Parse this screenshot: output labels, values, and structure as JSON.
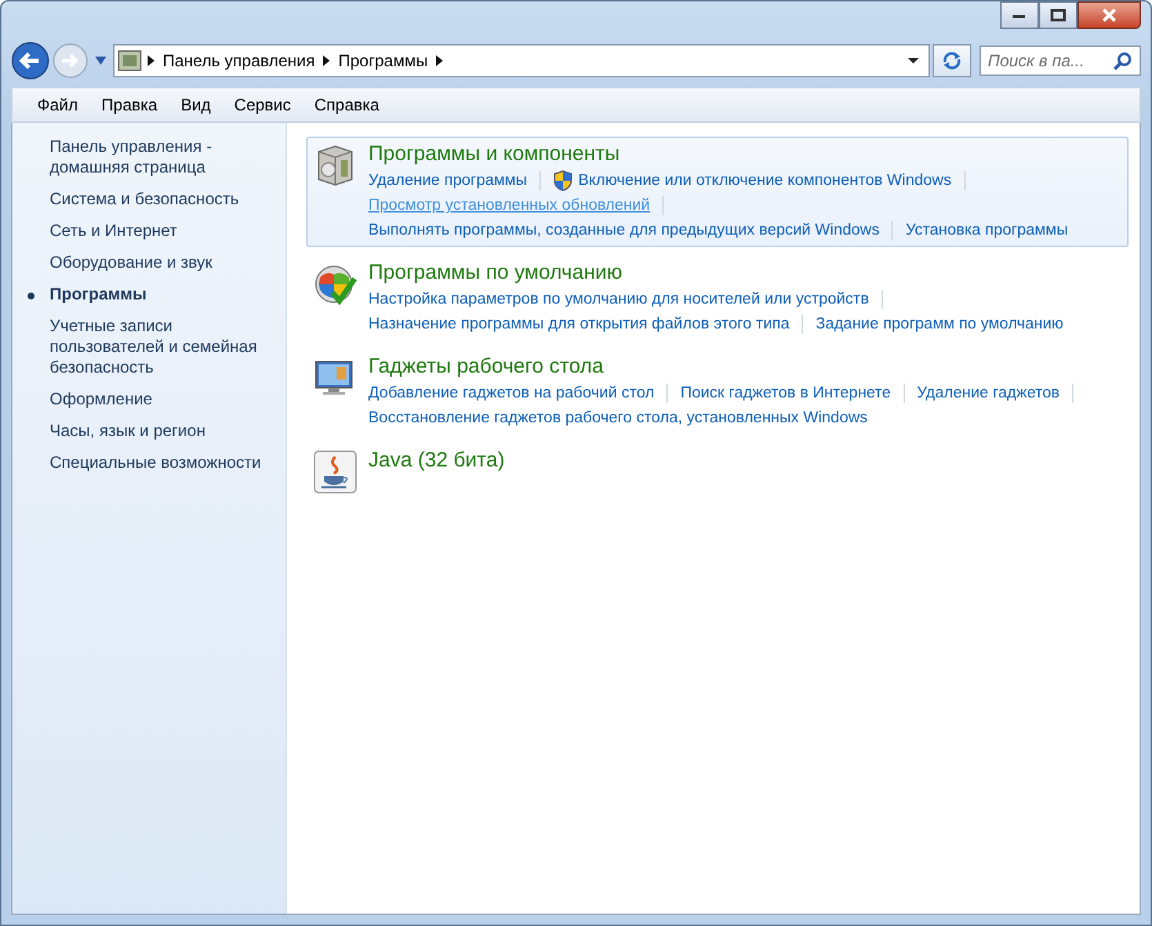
{
  "address": {
    "crumbs": [
      "Панель управления",
      "Программы"
    ]
  },
  "search": {
    "placeholder": "Поиск в па..."
  },
  "menu": [
    "Файл",
    "Правка",
    "Вид",
    "Сервис",
    "Справка"
  ],
  "sidebar": {
    "items": [
      {
        "label": "Панель управления - домашняя страница",
        "selected": false
      },
      {
        "label": "Система и безопасность",
        "selected": false
      },
      {
        "label": "Сеть и Интернет",
        "selected": false
      },
      {
        "label": "Оборудование и звук",
        "selected": false
      },
      {
        "label": "Программы",
        "selected": true
      },
      {
        "label": "Учетные записи пользователей и семейная безопасность",
        "selected": false
      },
      {
        "label": "Оформление",
        "selected": false
      },
      {
        "label": "Часы, язык и регион",
        "selected": false
      },
      {
        "label": "Специальные возможности",
        "selected": false
      }
    ]
  },
  "sections": [
    {
      "kind": "box",
      "title": "Программы и компоненты",
      "highlighted": true,
      "rows": [
        [
          {
            "label": "Удаление программы",
            "hovered": false,
            "shield": false
          },
          {
            "label": "Включение или отключение компонентов Windows",
            "hovered": false,
            "shield": true
          }
        ],
        [
          {
            "label": "Просмотр установленных обновлений",
            "hovered": true,
            "shield": false
          }
        ],
        [
          {
            "label": "Выполнять программы, созданные для предыдущих версий Windows",
            "hovered": false,
            "shield": false
          },
          {
            "label": "Установка программы",
            "hovered": false,
            "shield": false
          }
        ]
      ]
    },
    {
      "kind": "globe",
      "title": "Программы по умолчанию",
      "highlighted": false,
      "rows": [
        [
          {
            "label": "Настройка параметров по умолчанию для носителей или устройств",
            "hovered": false,
            "shield": false
          }
        ],
        [
          {
            "label": "Назначение программы для открытия файлов этого типа",
            "hovered": false,
            "shield": false
          },
          {
            "label": "Задание программ по умолчанию",
            "hovered": false,
            "shield": false
          }
        ]
      ]
    },
    {
      "kind": "monitor",
      "title": "Гаджеты рабочего стола",
      "highlighted": false,
      "rows": [
        [
          {
            "label": "Добавление гаджетов на рабочий стол",
            "hovered": false,
            "shield": false
          },
          {
            "label": "Поиск гаджетов в Интернете",
            "hovered": false,
            "shield": false
          },
          {
            "label": "Удаление гаджетов",
            "hovered": false,
            "shield": false
          }
        ],
        [
          {
            "label": "Восстановление гаджетов рабочего стола, установленных Windows",
            "hovered": false,
            "shield": false
          }
        ]
      ]
    },
    {
      "kind": "cup",
      "title": "Java (32 бита)",
      "highlighted": false
    }
  ]
}
